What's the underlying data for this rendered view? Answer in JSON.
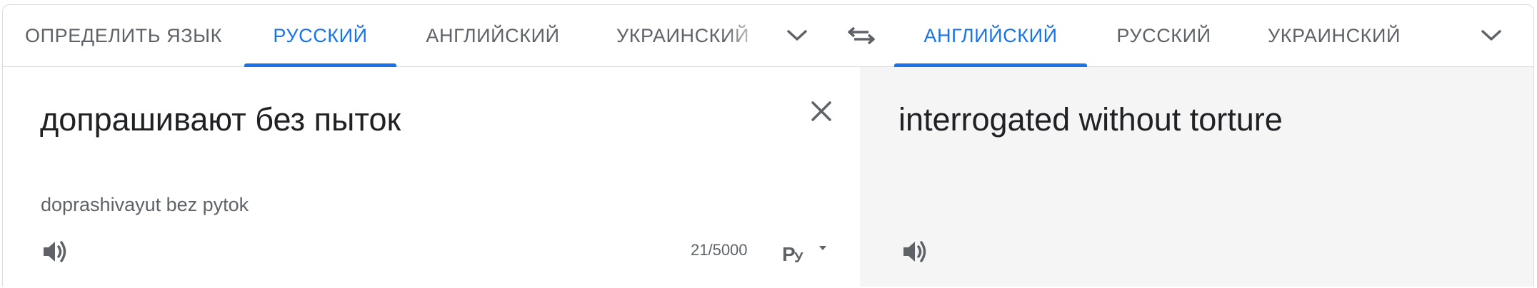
{
  "source_languages": {
    "tabs": [
      {
        "label": "ОПРЕДЕЛИТЬ ЯЗЫК",
        "active": false
      },
      {
        "label": "РУССКИЙ",
        "active": true
      },
      {
        "label": "АНГЛИЙСКИЙ",
        "active": false
      },
      {
        "label": "УКРАИНСКИЙ",
        "active": false
      }
    ],
    "more_icon": "chevron-down-icon"
  },
  "swap_icon": "swap-languages-icon",
  "target_languages": {
    "tabs": [
      {
        "label": "АНГЛИЙСКИЙ",
        "active": true
      },
      {
        "label": "РУССКИЙ",
        "active": false
      },
      {
        "label": "УКРАИНСКИЙ",
        "active": false
      }
    ],
    "more_icon": "chevron-down-icon"
  },
  "source": {
    "text": "допрашивают без пыток",
    "transliteration": "doprashivayut bez pytok",
    "char_count": "21/5000",
    "clear_icon": "close-icon",
    "listen_icon": "speaker-icon",
    "input_tool_icon": "keyboard-layout-icon"
  },
  "target": {
    "text": "interrogated without torture",
    "listen_icon": "speaker-icon"
  },
  "colors": {
    "accent": "#1a73e8",
    "text": "#202124",
    "muted": "#5f6368",
    "result_bg": "#f5f5f5",
    "border": "#dadce0"
  }
}
